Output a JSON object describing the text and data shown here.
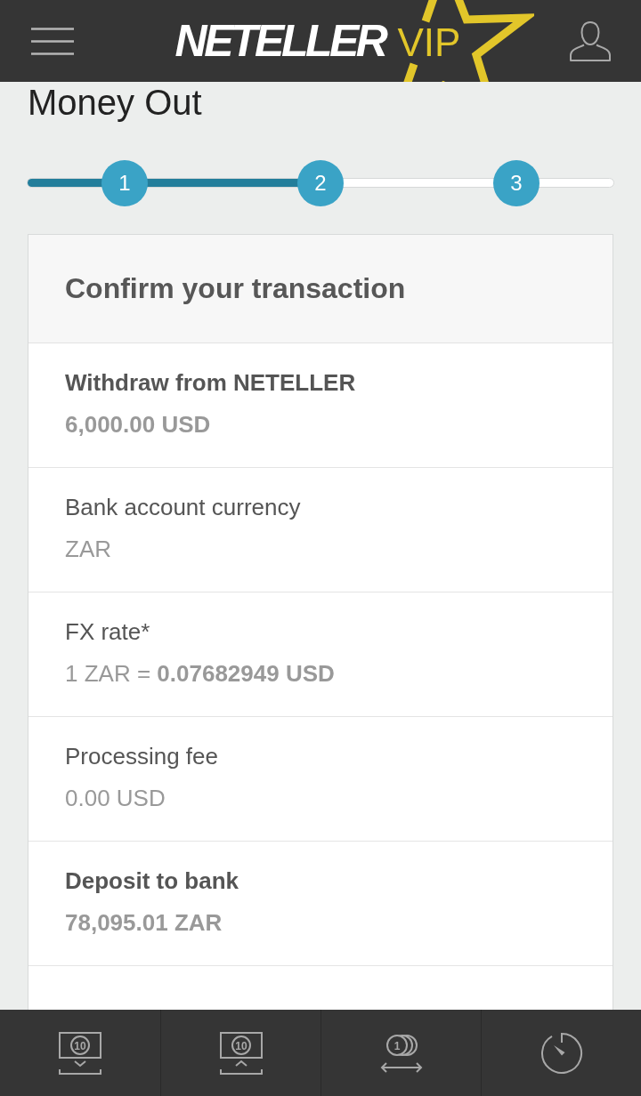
{
  "header": {
    "logo": {
      "brand": "NETELLER",
      "tier": "VIP"
    }
  },
  "page": {
    "title": "Money Out"
  },
  "stepper": {
    "level": 0.5,
    "steps": [
      "1",
      "2",
      "3"
    ]
  },
  "card": {
    "title": "Confirm your transaction",
    "rows": [
      {
        "kind": "strong",
        "label": "Withdraw from NETELLER",
        "value": "6,000.00 USD"
      },
      {
        "kind": "plain",
        "label": "Bank account currency",
        "value": "ZAR"
      },
      {
        "kind": "plain",
        "label": "FX rate*",
        "value": "1 ZAR = **0.07682949 USD**"
      },
      {
        "kind": "plain",
        "label": "Processing fee",
        "value": "0.00 USD"
      },
      {
        "kind": "strong",
        "label": "Deposit to bank",
        "value": "78,095.01 ZAR"
      }
    ]
  },
  "bottom_nav": {
    "items": [
      {
        "kind": "cash_out",
        "icon_text": "10"
      },
      {
        "kind": "cash_in",
        "icon_text": "10"
      },
      {
        "kind": "transfer",
        "icon_text": "1"
      },
      {
        "kind": "history"
      }
    ]
  }
}
